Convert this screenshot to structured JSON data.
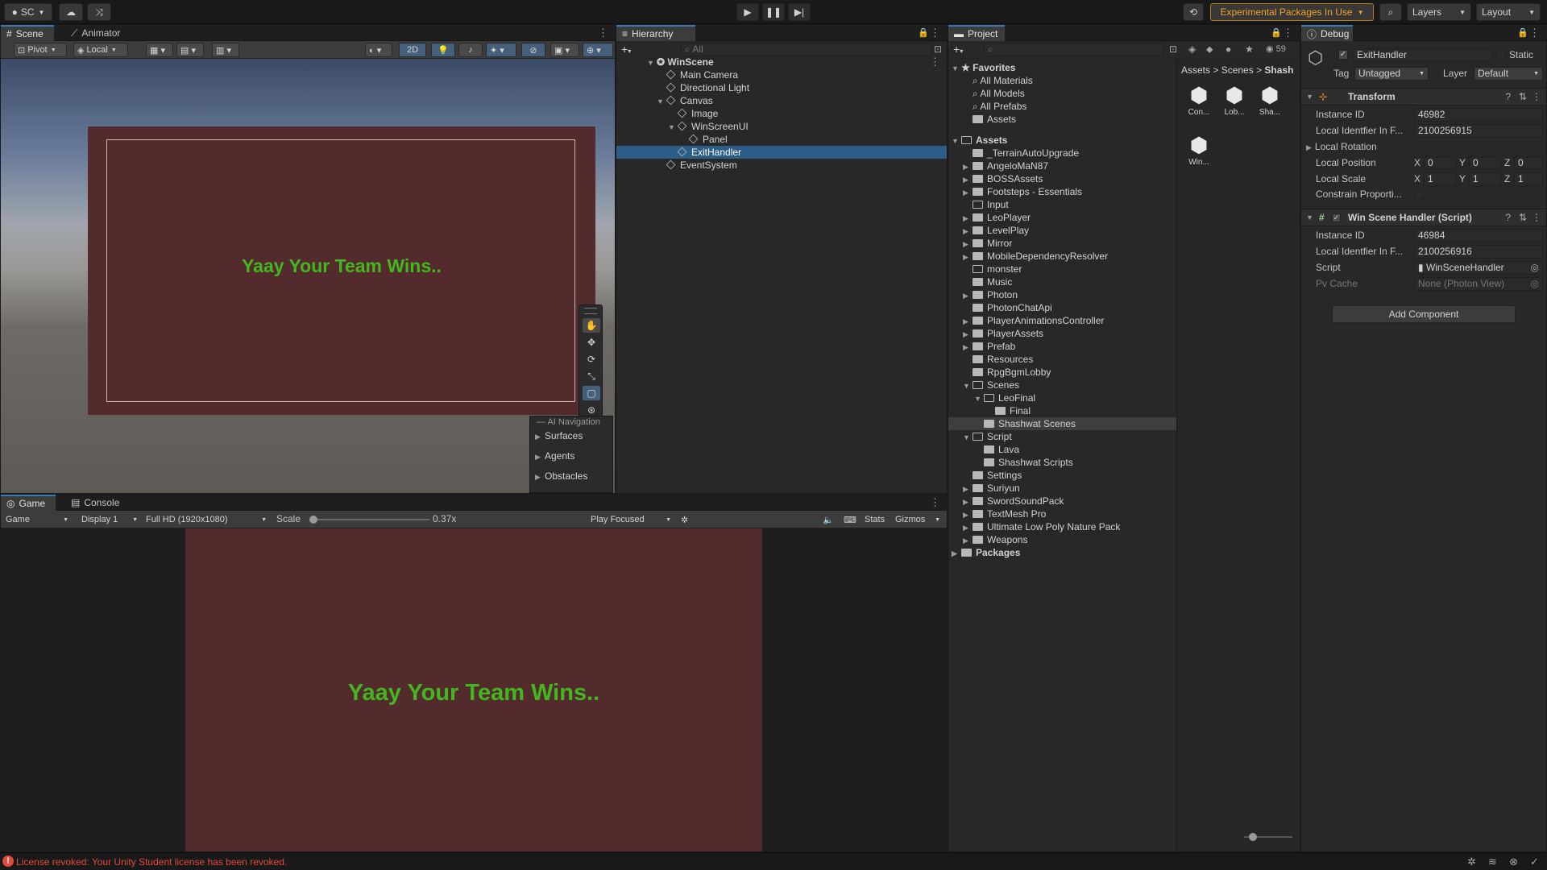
{
  "toolbar": {
    "account": "SC",
    "experimental": "Experimental Packages In Use",
    "layers": "Layers",
    "layout": "Layout"
  },
  "scene": {
    "tabs": [
      "Scene",
      "Animator"
    ],
    "pivot": "Pivot",
    "local": "Local",
    "mode_2d": "2D",
    "canvas_text": "Yaay Your Team Wins..",
    "canvas_color": "#532b2d",
    "text_color": "#43b71f",
    "overlay_title": "AI Navigation",
    "overlay_items": [
      "Surfaces",
      "Agents",
      "Obstacles"
    ]
  },
  "game": {
    "tabs": [
      "Game",
      "Console"
    ],
    "game_select": "Game",
    "display": "Display 1",
    "resolution": "Full HD (1920x1080)",
    "scale_label": "Scale",
    "scale_value": "0.37x",
    "play_focused": "Play Focused",
    "stats": "Stats",
    "gizmos": "Gizmos",
    "canvas_text": "Yaay Your Team Wins.."
  },
  "hierarchy": {
    "title": "Hierarchy",
    "search_placeholder": "All",
    "items": [
      "WinScene",
      "Main Camera",
      "Directional Light",
      "Canvas",
      "Image",
      "WinScreenUI",
      "Panel",
      "ExitHandler",
      "EventSystem"
    ]
  },
  "project": {
    "title": "Project",
    "eye_count": "59",
    "favorites_title": "Favorites",
    "favorites": [
      "All Materials",
      "All Models",
      "All Prefabs",
      "Assets"
    ],
    "assets_title": "Assets",
    "assets": [
      "_TerrainAutoUpgrade",
      "AngeloMaN87",
      "BOSSAssets",
      "Footsteps - Essentials",
      "Input",
      "LeoPlayer",
      "LevelPlay",
      "Mirror",
      "MobileDependencyResolver",
      "monster",
      "Music",
      "Photon",
      "PhotonChatApi",
      "PlayerAnimationsController",
      "PlayerAssets",
      "Prefab",
      "Resources",
      "RpgBgmLobby",
      "Scenes",
      "LeoFinal",
      "Final",
      "Shashwat Scenes",
      "Script",
      "Lava",
      "Shashwat Scripts",
      "Settings",
      "Suriyun",
      "SwordSoundPack",
      "TextMesh Pro",
      "Ultimate Low Poly Nature Pack",
      "Weapons"
    ],
    "packages": "Packages",
    "breadcrumb": [
      "Assets",
      "Scenes",
      "Shash"
    ],
    "grid_items": [
      "Con...",
      "Lob...",
      "Sha...",
      "Win..."
    ]
  },
  "inspector": {
    "title": "Debug",
    "object_name": "ExitHandler",
    "static_label": "Static",
    "tag_label": "Tag",
    "tag_value": "Untagged",
    "layer_label": "Layer",
    "layer_value": "Default",
    "transform": {
      "title": "Transform",
      "instance_id_label": "Instance ID",
      "instance_id": "46982",
      "local_id_label": "Local Identfier In F...",
      "local_id": "2100256915",
      "local_rotation": "Local Rotation",
      "local_position": "Local Position",
      "local_scale": "Local Scale",
      "constrain": "Constrain Proporti...",
      "pos": [
        "0",
        "0",
        "0"
      ],
      "scale": [
        "1",
        "1",
        "1"
      ],
      "axes": [
        "X",
        "Y",
        "Z"
      ]
    },
    "script_comp": {
      "title": "Win Scene Handler (Script)",
      "instance_id_label": "Instance ID",
      "instance_id": "46984",
      "local_id_label": "Local Identfier In F...",
      "local_id": "2100256916",
      "script_label": "Script",
      "script_value": "WinSceneHandler",
      "pv_label": "Pv Cache",
      "pv_value": "None (Photon View)"
    },
    "add_component": "Add Component"
  },
  "status": {
    "message": "License revoked: Your Unity Student license has been revoked.",
    "color": "#e04b3c"
  }
}
